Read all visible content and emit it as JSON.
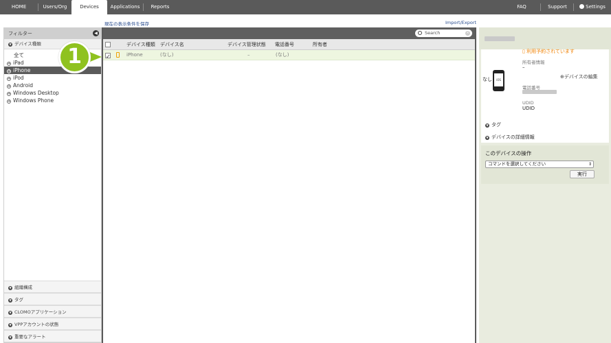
{
  "nav": {
    "home": "HOME",
    "users_org": "Users/Org",
    "devices": "Devices",
    "applications": "Applications",
    "reports": "Reports",
    "faq": "FAQ",
    "support": "Support",
    "settings": "Settings"
  },
  "links": {
    "save_view": "現在の表示条件を保存",
    "import_export": "Import/Export"
  },
  "sidebar": {
    "filter_title": "フィルター",
    "device_type_section": "デバイス種類",
    "device_types": [
      "全て",
      "iPad",
      "iPhone",
      "iPod",
      "Android",
      "Windows Desktop",
      "Windows Phone"
    ],
    "selected_type": "iPhone",
    "bottom_sections": [
      "組織構成",
      "タグ",
      "CLOMOアプリケーション",
      "VPPアカウントの状態",
      "重要なアラート"
    ]
  },
  "table": {
    "search_placeholder": "Search",
    "headers": {
      "type": "デバイス種類",
      "name": "デバイス名",
      "mgmt_status": "デバイス管理状態",
      "phone": "電話番号",
      "owner": "所有者"
    },
    "rows": [
      {
        "type": "iPhone",
        "name": "(なし)",
        "mgmt_status": "–",
        "phone": "(なし)",
        "owner": ""
      }
    ]
  },
  "detail": {
    "reservation_status": "利用予約されています",
    "owner_label": "所有者情報",
    "owner_value": "–",
    "edit_device": "デバイスの編集",
    "device_name_value": "なし",
    "phone_label": "電話番号",
    "udid_label": "UDID",
    "udid_value": "UDID",
    "tags_section": "タグ",
    "details_section": "デバイスの詳細情報",
    "operations_title": "このデバイスの操作",
    "command_select": "コマンドを選択してください",
    "run_button": "実行"
  },
  "step_badge": "1",
  "colors": {
    "nav_bg": "#5a5a5a",
    "selected_row": "#eef6e0",
    "accent_green": "#8fc21f",
    "warning_orange": "#f08000"
  }
}
